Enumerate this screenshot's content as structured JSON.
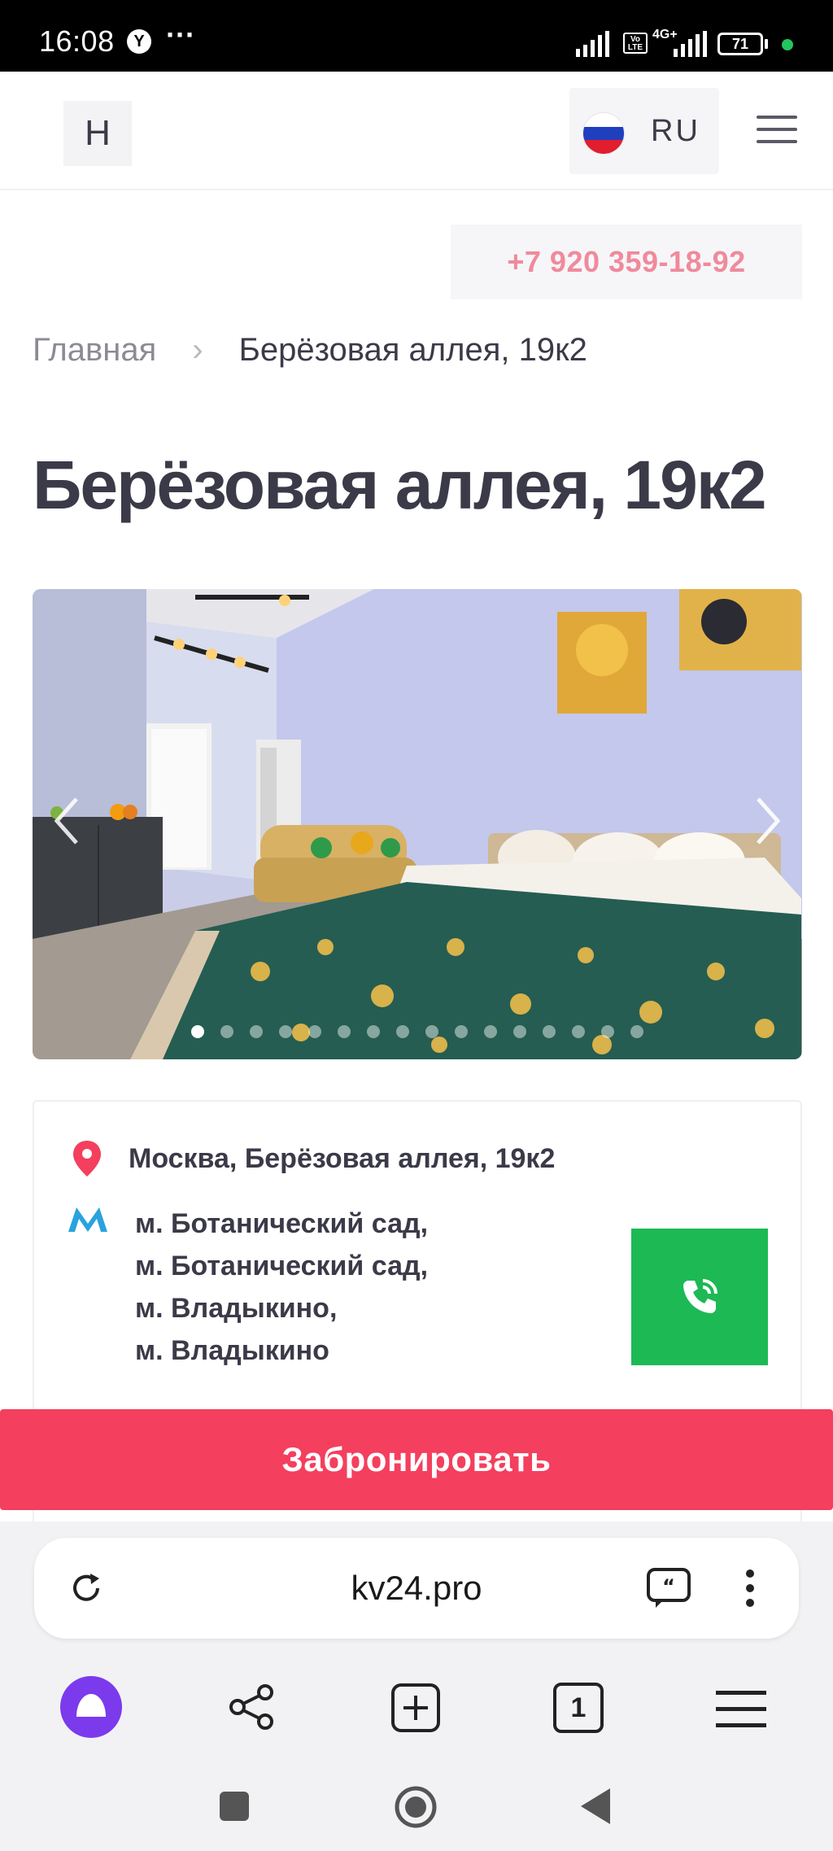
{
  "status_bar": {
    "time": "16:08",
    "more_dots": "···",
    "network": "4G+",
    "volte": "Vo LTE",
    "battery": "71"
  },
  "header": {
    "logo": "H",
    "language": "RU"
  },
  "phone": "+7 920 359-18-92",
  "breadcrumb": {
    "home": "Главная",
    "separator": "›",
    "current": "Берёзовая аллея, 19к2"
  },
  "title": "Берёзовая аллея, 19к2",
  "gallery": {
    "slide_count": 16,
    "active_index": 0
  },
  "info": {
    "address": "Москва, Берёзовая аллея, 19к2",
    "metro_icon": "М",
    "metro": [
      "м. Ботанический сад,",
      "м. Ботанический сад,",
      "м. Владыкино,",
      "м. Владыкино"
    ]
  },
  "book_label": "Забронировать",
  "browser": {
    "url": "kv24.pro",
    "tab_count": "1"
  },
  "colors": {
    "accent": "#f43f5e",
    "phone_text": "#f08a9c",
    "call_button": "#1db954",
    "assistant": "#7c3aed"
  }
}
